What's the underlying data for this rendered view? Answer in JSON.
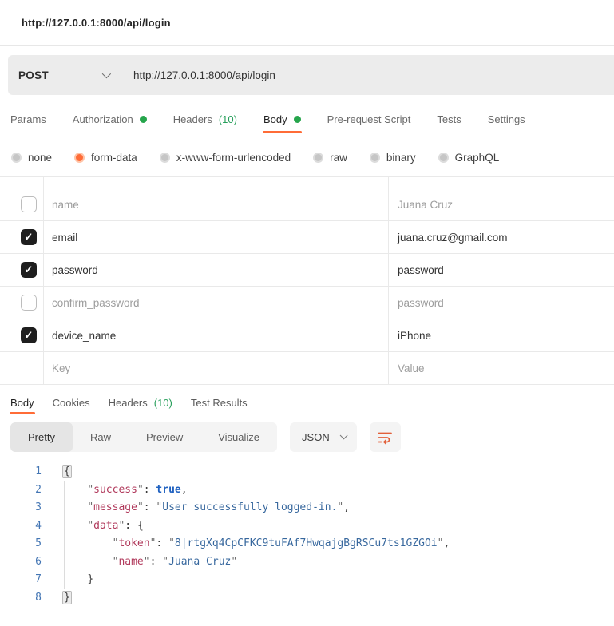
{
  "window": {
    "title": "http://127.0.0.1:8000/api/login"
  },
  "colors": {
    "accent_orange": "#ff6c37",
    "status_green_dot": "#26a54c",
    "count_green": "#279f5b",
    "json_key": "#b13a5c",
    "json_string": "#38689e",
    "json_bool": "#1f61c0",
    "line_number_blue": "#4476b4"
  },
  "request": {
    "method": "POST",
    "url": "http://127.0.0.1:8000/api/login",
    "tabs": [
      {
        "label": "Params"
      },
      {
        "label": "Authorization",
        "dot": true
      },
      {
        "label": "Headers",
        "count": "(10)"
      },
      {
        "label": "Body",
        "dot": true,
        "active": true
      },
      {
        "label": "Pre-request Script"
      },
      {
        "label": "Tests"
      },
      {
        "label": "Settings"
      }
    ],
    "body_types": [
      {
        "label": "none"
      },
      {
        "label": "form-data",
        "selected": true
      },
      {
        "label": "x-www-form-urlencoded"
      },
      {
        "label": "raw"
      },
      {
        "label": "binary"
      },
      {
        "label": "GraphQL"
      }
    ],
    "form_rows": [
      {
        "checked": false,
        "key": "name",
        "value": "Juana Cruz",
        "muted": true
      },
      {
        "checked": true,
        "key": "email",
        "value": "juana.cruz@gmail.com"
      },
      {
        "checked": true,
        "key": "password",
        "value": "password"
      },
      {
        "checked": false,
        "key": "confirm_password",
        "value": "password",
        "muted": true
      },
      {
        "checked": true,
        "key": "device_name",
        "value": "iPhone"
      },
      {
        "placeholder": true,
        "key": "Key",
        "value": "Value",
        "muted": true
      }
    ]
  },
  "response": {
    "tabs": [
      {
        "label": "Body",
        "active": true
      },
      {
        "label": "Cookies"
      },
      {
        "label": "Headers",
        "count": "(10)"
      },
      {
        "label": "Test Results"
      }
    ],
    "view_modes": [
      {
        "label": "Pretty",
        "active": true
      },
      {
        "label": "Raw"
      },
      {
        "label": "Preview"
      },
      {
        "label": "Visualize"
      }
    ],
    "format": "JSON",
    "code_lines": [
      {
        "num": 1,
        "tokens": [
          [
            "bhl",
            "{"
          ]
        ]
      },
      {
        "num": 2,
        "tokens": [
          [
            "ws",
            "    "
          ],
          [
            "q",
            "\""
          ],
          [
            "key",
            "success"
          ],
          [
            "q",
            "\""
          ],
          [
            "p",
            ": "
          ],
          [
            "bool",
            "true"
          ],
          [
            "p",
            ","
          ]
        ]
      },
      {
        "num": 3,
        "tokens": [
          [
            "ws",
            "    "
          ],
          [
            "q",
            "\""
          ],
          [
            "key",
            "message"
          ],
          [
            "q",
            "\""
          ],
          [
            "p",
            ": "
          ],
          [
            "q",
            "\""
          ],
          [
            "str",
            "User successfully logged-in."
          ],
          [
            "q",
            "\""
          ],
          [
            "p",
            ","
          ]
        ]
      },
      {
        "num": 4,
        "tokens": [
          [
            "ws",
            "    "
          ],
          [
            "q",
            "\""
          ],
          [
            "key",
            "data"
          ],
          [
            "q",
            "\""
          ],
          [
            "p",
            ": "
          ],
          [
            "b",
            "{"
          ]
        ]
      },
      {
        "num": 5,
        "tokens": [
          [
            "ws",
            "        "
          ],
          [
            "q",
            "\""
          ],
          [
            "key",
            "token"
          ],
          [
            "q",
            "\""
          ],
          [
            "p",
            ": "
          ],
          [
            "q",
            "\""
          ],
          [
            "str",
            "8|rtgXq4CpCFKC9tuFAf7HwqajgBgRSCu7ts1GZGOi"
          ],
          [
            "q",
            "\""
          ],
          [
            "p",
            ","
          ]
        ]
      },
      {
        "num": 6,
        "tokens": [
          [
            "ws",
            "        "
          ],
          [
            "q",
            "\""
          ],
          [
            "key",
            "name"
          ],
          [
            "q",
            "\""
          ],
          [
            "p",
            ": "
          ],
          [
            "q",
            "\""
          ],
          [
            "str",
            "Juana Cruz"
          ],
          [
            "q",
            "\""
          ]
        ]
      },
      {
        "num": 7,
        "tokens": [
          [
            "ws",
            "    "
          ],
          [
            "b",
            "}"
          ]
        ]
      },
      {
        "num": 8,
        "tokens": [
          [
            "bhl",
            "}"
          ]
        ]
      }
    ]
  }
}
